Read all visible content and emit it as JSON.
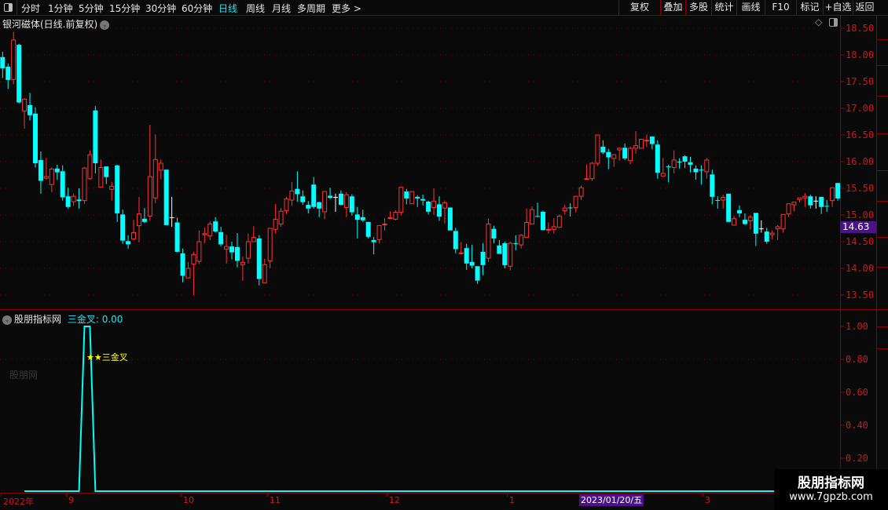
{
  "toolbar": {
    "periods": [
      "分时",
      "1分钟",
      "5分钟",
      "15分钟",
      "30分钟",
      "60分钟",
      "日线",
      "周线",
      "月线",
      "多周期",
      "更多 >"
    ],
    "active_period": "日线",
    "right_buttons": [
      "复权",
      "叠加",
      "多股",
      "统计",
      "画线",
      "F10",
      "标记",
      "+自选",
      "返回"
    ]
  },
  "main_chart": {
    "title": "银河磁体(日线.前复权)",
    "price_ticks": [
      "18.50",
      "18.00",
      "17.50",
      "17.00",
      "16.50",
      "16.00",
      "15.50",
      "15.00",
      "14.50",
      "14.00",
      "13.50"
    ],
    "current_price_tag": "14.63",
    "colors": {
      "up": "#ff3232",
      "down": "#00ffff",
      "flat": "#ffffff",
      "axis": "#d01818",
      "grid": "#5a0a0a"
    }
  },
  "indicator": {
    "source_name": "股朋指标网",
    "series_label": "三金叉:",
    "series_value": "0.00",
    "signal_label": "★★三金叉",
    "ticks": [
      "1.00",
      "0.80",
      "0.60",
      "0.40",
      "0.20"
    ],
    "watermark": "股朋网",
    "line_color": "#00ffff"
  },
  "date_axis": {
    "labels": [
      "2022年",
      "9",
      "10",
      "11",
      "12",
      "1",
      "3"
    ],
    "cursor_date": "2023/01/20/五"
  },
  "watermark_box": {
    "name": "股朋指标网",
    "url": "www.7gpzb.com"
  },
  "chart_data": {
    "type": "candlestick",
    "ylim": [
      13.5,
      18.5
    ],
    "fields": [
      "open",
      "high",
      "low",
      "close"
    ],
    "candles": [
      [
        17.96,
        18.06,
        17.57,
        17.75
      ],
      [
        17.78,
        17.84,
        17.36,
        17.53
      ],
      [
        17.54,
        18.43,
        17.45,
        18.28
      ],
      [
        18.19,
        18.21,
        17.09,
        17.11
      ],
      [
        16.95,
        17.19,
        16.62,
        17.17
      ],
      [
        17.06,
        17.29,
        16.77,
        16.87
      ],
      [
        16.9,
        17.02,
        15.89,
        15.97
      ],
      [
        16.03,
        16.19,
        15.4,
        15.64
      ],
      [
        15.69,
        16.07,
        15.66,
        15.72
      ],
      [
        15.57,
        15.89,
        15.43,
        15.86
      ],
      [
        15.87,
        15.94,
        15.66,
        15.8
      ],
      [
        15.82,
        15.93,
        15.27,
        15.33
      ],
      [
        15.35,
        15.51,
        15.12,
        15.15
      ],
      [
        15.25,
        15.4,
        15.17,
        15.35
      ],
      [
        15.29,
        15.5,
        15.12,
        15.26
      ],
      [
        15.27,
        15.9,
        15.21,
        15.88
      ],
      [
        15.68,
        16.21,
        15.66,
        16.13
      ],
      [
        16.96,
        17.04,
        15.78,
        15.97
      ],
      [
        15.52,
        16.04,
        15.52,
        15.89
      ],
      [
        15.91,
        15.91,
        15.58,
        15.71
      ],
      [
        15.48,
        15.62,
        15.27,
        15.54
      ],
      [
        15.93,
        15.94,
        14.87,
        15.03
      ],
      [
        15.01,
        15.1,
        14.46,
        14.52
      ],
      [
        14.51,
        14.62,
        14.37,
        14.45
      ],
      [
        14.55,
        14.91,
        14.52,
        14.67
      ],
      [
        14.8,
        15.34,
        14.49,
        15.02
      ],
      [
        14.93,
        15.13,
        14.85,
        14.87
      ],
      [
        14.98,
        16.69,
        14.89,
        15.72
      ],
      [
        15.32,
        16.51,
        15.22,
        16.04
      ],
      [
        15.84,
        16.04,
        15.67,
        15.97
      ],
      [
        15.85,
        15.85,
        14.81,
        14.81
      ],
      [
        14.95,
        15.34,
        14.78,
        14.95
      ],
      [
        14.86,
        14.95,
        14.3,
        14.31
      ],
      [
        14.28,
        14.37,
        13.74,
        13.86
      ],
      [
        13.82,
        14.12,
        13.82,
        14.0
      ],
      [
        14.08,
        14.31,
        13.49,
        14.26
      ],
      [
        14.13,
        14.71,
        14.08,
        14.5
      ],
      [
        14.63,
        14.76,
        14.47,
        14.65
      ],
      [
        14.61,
        14.88,
        14.53,
        14.83
      ],
      [
        14.88,
        14.96,
        14.67,
        14.69
      ],
      [
        14.68,
        14.78,
        14.41,
        14.45
      ],
      [
        14.36,
        14.63,
        14.09,
        14.41
      ],
      [
        14.41,
        14.5,
        14.17,
        14.3
      ],
      [
        14.4,
        14.66,
        14.02,
        14.14
      ],
      [
        14.07,
        14.22,
        13.77,
        14.11
      ],
      [
        14.19,
        14.65,
        14.09,
        14.5
      ],
      [
        14.5,
        14.79,
        14.5,
        14.58
      ],
      [
        14.56,
        14.62,
        13.68,
        13.8
      ],
      [
        13.73,
        14.18,
        13.73,
        14.07
      ],
      [
        14.14,
        14.76,
        14.0,
        14.75
      ],
      [
        14.73,
        15.21,
        14.65,
        14.92
      ],
      [
        14.83,
        15.13,
        14.78,
        15.07
      ],
      [
        15.08,
        15.34,
        15.02,
        15.3
      ],
      [
        15.28,
        15.62,
        15.17,
        15.45
      ],
      [
        15.49,
        15.82,
        15.25,
        15.39
      ],
      [
        15.35,
        15.46,
        15.19,
        15.24
      ],
      [
        15.19,
        15.26,
        15.03,
        15.12
      ],
      [
        15.57,
        15.71,
        15.12,
        15.15
      ],
      [
        15.24,
        15.25,
        14.96,
        15.12
      ],
      [
        15.06,
        15.44,
        14.92,
        15.44
      ],
      [
        15.36,
        15.51,
        15.3,
        15.32
      ],
      [
        15.33,
        15.4,
        15.06,
        15.33
      ],
      [
        15.4,
        15.46,
        15.18,
        15.19
      ],
      [
        15.14,
        15.43,
        14.96,
        15.38
      ],
      [
        15.35,
        15.39,
        14.99,
        15.05
      ],
      [
        15.01,
        15.15,
        14.56,
        14.91
      ],
      [
        14.96,
        15.1,
        14.87,
        14.9
      ],
      [
        14.87,
        14.87,
        14.56,
        14.59
      ],
      [
        14.53,
        14.59,
        14.26,
        14.49
      ],
      [
        14.54,
        14.8,
        14.47,
        14.8
      ],
      [
        14.82,
        14.94,
        14.71,
        14.83
      ],
      [
        14.94,
        15.07,
        14.93,
        14.95
      ],
      [
        14.92,
        15.09,
        14.9,
        15.05
      ],
      [
        15.05,
        15.52,
        14.99,
        15.52
      ],
      [
        15.44,
        15.49,
        15.2,
        15.31
      ],
      [
        15.21,
        15.44,
        15.21,
        15.44
      ],
      [
        15.34,
        15.37,
        15.15,
        15.31
      ],
      [
        15.3,
        15.38,
        15.18,
        15.27
      ],
      [
        15.25,
        15.27,
        15.01,
        15.06
      ],
      [
        15.14,
        15.5,
        15.0,
        15.26
      ],
      [
        15.2,
        15.35,
        14.89,
        14.97
      ],
      [
        15.13,
        15.27,
        14.84,
        15.23
      ],
      [
        15.14,
        15.14,
        14.71,
        14.71
      ],
      [
        14.7,
        14.76,
        14.28,
        14.36
      ],
      [
        14.28,
        14.49,
        14.26,
        14.29
      ],
      [
        14.38,
        14.46,
        13.97,
        14.09
      ],
      [
        14.12,
        14.44,
        14.0,
        14.05
      ],
      [
        14.04,
        14.04,
        13.71,
        13.77
      ],
      [
        14.31,
        14.47,
        13.87,
        14.06
      ],
      [
        14.19,
        14.93,
        14.12,
        14.83
      ],
      [
        14.74,
        14.8,
        14.47,
        14.56
      ],
      [
        14.43,
        14.53,
        14.27,
        14.27
      ],
      [
        14.47,
        14.5,
        14.0,
        14.06
      ],
      [
        14.04,
        14.5,
        13.96,
        14.47
      ],
      [
        14.47,
        14.62,
        14.34,
        14.46
      ],
      [
        14.44,
        14.64,
        14.37,
        14.62
      ],
      [
        14.58,
        15.12,
        14.58,
        14.86
      ],
      [
        14.83,
        15.16,
        14.83,
        15.1
      ],
      [
        14.98,
        15.23,
        14.96,
        14.97
      ],
      [
        15.06,
        15.08,
        14.71,
        14.72
      ],
      [
        14.72,
        14.86,
        14.65,
        14.73
      ],
      [
        14.73,
        14.94,
        14.65,
        14.78
      ],
      [
        14.77,
        15.01,
        14.76,
        14.98
      ],
      [
        15.08,
        15.19,
        15.01,
        15.13
      ],
      [
        15.14,
        15.22,
        14.97,
        15.13
      ],
      [
        15.14,
        15.35,
        15.05,
        15.35
      ],
      [
        15.35,
        15.55,
        15.28,
        15.51
      ],
      [
        15.67,
        15.94,
        15.66,
        15.68
      ],
      [
        15.68,
        15.99,
        15.64,
        15.97
      ],
      [
        15.97,
        16.5,
        15.92,
        16.5
      ],
      [
        16.28,
        16.4,
        16.14,
        16.17
      ],
      [
        16.18,
        16.24,
        15.86,
        16.08
      ],
      [
        16.06,
        16.13,
        15.9,
        16.13
      ],
      [
        16.22,
        16.26,
        16.02,
        16.25
      ],
      [
        16.26,
        16.34,
        16.03,
        16.06
      ],
      [
        16.02,
        16.28,
        15.95,
        16.25
      ],
      [
        16.25,
        16.57,
        16.15,
        16.3
      ],
      [
        16.25,
        16.42,
        16.24,
        16.42
      ],
      [
        16.39,
        16.51,
        16.27,
        16.4
      ],
      [
        16.47,
        16.47,
        16.23,
        16.33
      ],
      [
        16.32,
        16.4,
        15.68,
        15.79
      ],
      [
        15.73,
        16.07,
        15.73,
        15.78
      ],
      [
        15.91,
        15.94,
        15.61,
        15.9
      ],
      [
        15.89,
        16.21,
        15.78,
        16.03
      ],
      [
        16.0,
        16.06,
        15.87,
        15.99
      ],
      [
        16.1,
        16.12,
        15.88,
        16.0
      ],
      [
        15.99,
        16.09,
        15.8,
        15.94
      ],
      [
        15.87,
        15.93,
        15.66,
        15.8
      ],
      [
        15.85,
        15.93,
        15.57,
        15.84
      ],
      [
        15.81,
        16.07,
        15.68,
        16.03
      ],
      [
        15.76,
        15.85,
        15.2,
        15.34
      ],
      [
        15.28,
        15.35,
        15.12,
        15.27
      ],
      [
        15.28,
        15.38,
        15.12,
        15.33
      ],
      [
        15.4,
        15.4,
        14.87,
        14.87
      ],
      [
        14.81,
        14.98,
        14.8,
        14.93
      ],
      [
        15.09,
        15.18,
        14.96,
        15.03
      ],
      [
        14.91,
        15.03,
        14.81,
        14.83
      ],
      [
        14.89,
        15.0,
        14.73,
        14.96
      ],
      [
        15.04,
        15.04,
        14.42,
        14.65
      ],
      [
        14.74,
        14.9,
        14.67,
        14.74
      ],
      [
        14.69,
        14.76,
        14.46,
        14.5
      ],
      [
        14.63,
        14.71,
        14.54,
        14.66
      ],
      [
        14.74,
        14.81,
        14.53,
        14.78
      ],
      [
        14.74,
        15.01,
        14.67,
        15.01
      ],
      [
        15.02,
        15.21,
        14.96,
        15.21
      ],
      [
        15.19,
        15.25,
        15.07,
        15.24
      ],
      [
        15.29,
        15.32,
        15.24,
        15.32
      ],
      [
        15.32,
        15.41,
        15.15,
        15.35
      ],
      [
        15.35,
        15.38,
        15.12,
        15.18
      ],
      [
        15.26,
        15.35,
        15.12,
        15.26
      ],
      [
        15.34,
        15.34,
        15.02,
        15.15
      ],
      [
        15.17,
        15.28,
        15.06,
        15.16
      ],
      [
        15.27,
        15.51,
        15.15,
        15.51
      ],
      [
        15.6,
        15.6,
        15.27,
        15.31
      ]
    ],
    "indicator_series": {
      "name": "三金叉",
      "start_index": 4,
      "ylim": [
        0,
        1
      ],
      "ones_at": [
        15,
        16
      ]
    }
  }
}
